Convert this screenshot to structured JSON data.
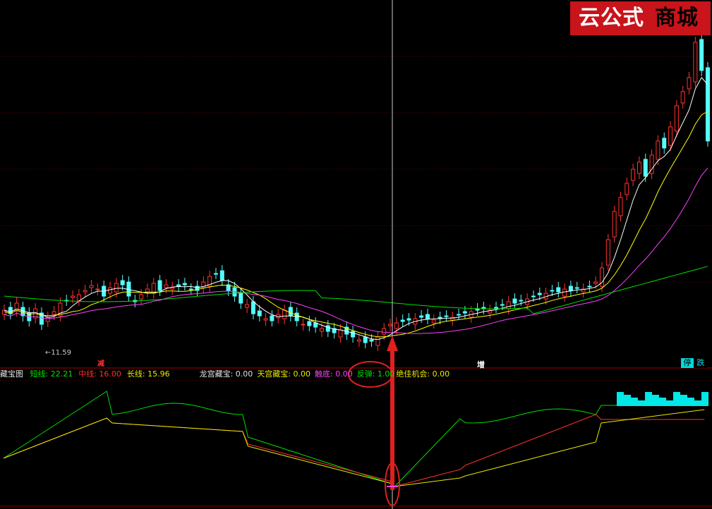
{
  "brand": {
    "part1": "云公式",
    "part2": "商城"
  },
  "price_low_label": "←11.59",
  "markers": {
    "left": "减",
    "mid": "增",
    "stop": "停",
    "drop": "跌"
  },
  "indicator": {
    "name": "藏宝图",
    "items": [
      {
        "label": "短线: 22.21",
        "color": "#00e000"
      },
      {
        "label": "中线: 16.00",
        "color": "#ff3030"
      },
      {
        "label": "长线: 15.96",
        "color": "#e8e800"
      },
      {
        "label": "龙宫藏宝: 0.00",
        "color": "#e0e0e0"
      },
      {
        "label": "天宫藏宝: 0.00",
        "color": "#e8e800"
      },
      {
        "label": "触底: 0.00",
        "color": "#ff40ff"
      },
      {
        "label": "反弹: 1.00",
        "color": "#00e000"
      },
      {
        "label": "绝佳机会: 0.00",
        "color": "#e8e800"
      }
    ]
  },
  "colors": {
    "up": "#ff3232",
    "down": "#54ffff",
    "ma5": "#ffffff",
    "ma10": "#ffff00",
    "ma20": "#ff40ff",
    "ma60": "#00e000",
    "grid": "#7a0000",
    "cursor": "#cccccc",
    "annotation": "#e02020"
  }
}
